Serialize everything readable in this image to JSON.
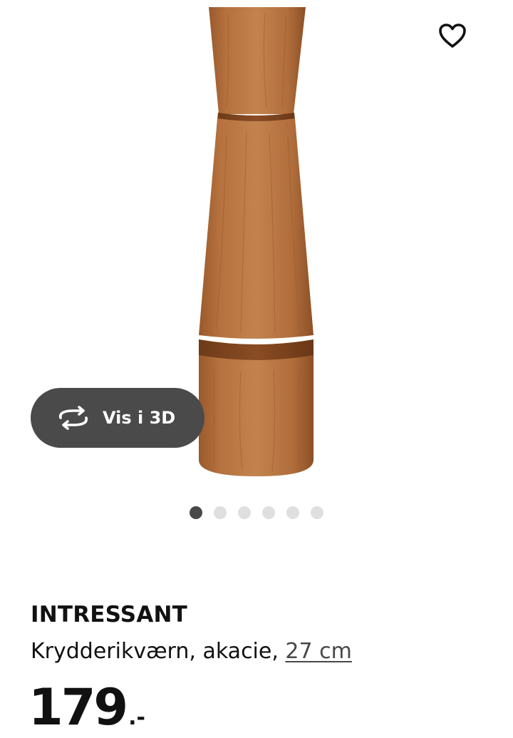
{
  "product": {
    "image_alt": "Krydderikværn i akacie",
    "name": "INTRESSANT",
    "description": "Krydderikværn, akacie, ",
    "size_link": "27 cm",
    "price_integer": "179",
    "price_suffix": ".-"
  },
  "view3d": {
    "label": "Vis i 3D",
    "icon": "rotate-360-icon"
  },
  "favorite": {
    "icon": "heart-outline-icon"
  },
  "carousel": {
    "total": 6,
    "active_index": 0
  },
  "colors": {
    "view3d_bg": "#4a4a4a",
    "dot_active": "#484848",
    "dot_inactive": "#dfdfdf",
    "text": "#111111"
  }
}
